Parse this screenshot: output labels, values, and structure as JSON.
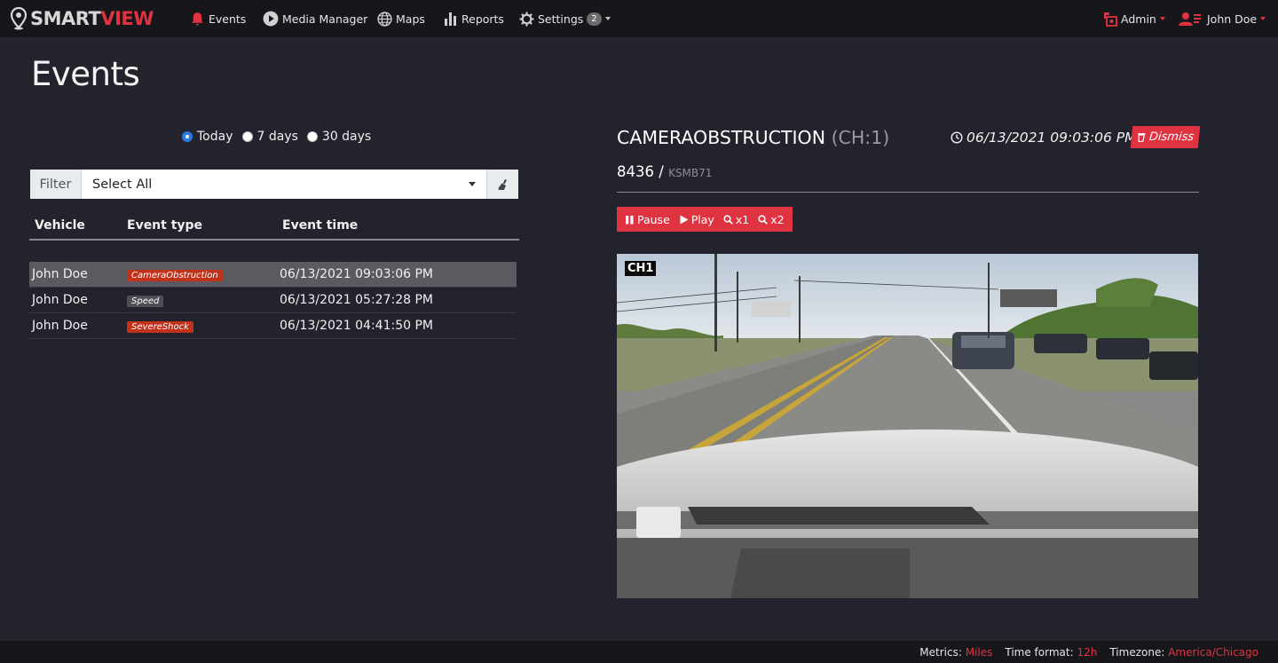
{
  "brand": {
    "part1": "SMART",
    "part2": "VIEW",
    "brand_color": "#e03341"
  },
  "nav": {
    "events": "Events",
    "media_manager": "Media Manager",
    "maps": "Maps",
    "reports": "Reports",
    "settings": "Settings",
    "settings_badge": "2",
    "admin": "Admin",
    "user": "John Doe"
  },
  "page": {
    "title": "Events"
  },
  "range": {
    "options": [
      "Today",
      "7 days",
      "30 days"
    ],
    "selected": "Today"
  },
  "filter": {
    "label": "Filter",
    "value": "Select All"
  },
  "table": {
    "headers": [
      "Vehicle",
      "Event type",
      "Event time"
    ],
    "rows": [
      {
        "vehicle": "John Doe",
        "type": "CameraObstruction",
        "time": "06/13/2021 09:03:06 PM",
        "tag_color": "red",
        "selected": true
      },
      {
        "vehicle": "John Doe",
        "type": "Speed",
        "time": "06/13/2021 05:27:28 PM",
        "tag_color": "gray",
        "selected": false
      },
      {
        "vehicle": "John Doe",
        "type": "SevereShock",
        "time": "06/13/2021 04:41:50 PM",
        "tag_color": "red",
        "selected": false
      }
    ]
  },
  "event": {
    "title": "CAMERAOBSTRUCTION",
    "channel": "(CH:1)",
    "time": "06/13/2021 09:03:06 PM",
    "dismiss": "Dismiss",
    "vehicle_id": "8436",
    "separator": "/",
    "plate": "KSMB71"
  },
  "controls": {
    "pause": "Pause",
    "play": "Play",
    "zoom1": "x1",
    "zoom2": "x2"
  },
  "video": {
    "channel_label": "CH1"
  },
  "footer": {
    "metrics_label": "Metrics:",
    "metrics_value": "Miles",
    "time_format_label": "Time format:",
    "time_format_value": "12h",
    "timezone_label": "Timezone:",
    "timezone_value": "America/Chicago"
  }
}
